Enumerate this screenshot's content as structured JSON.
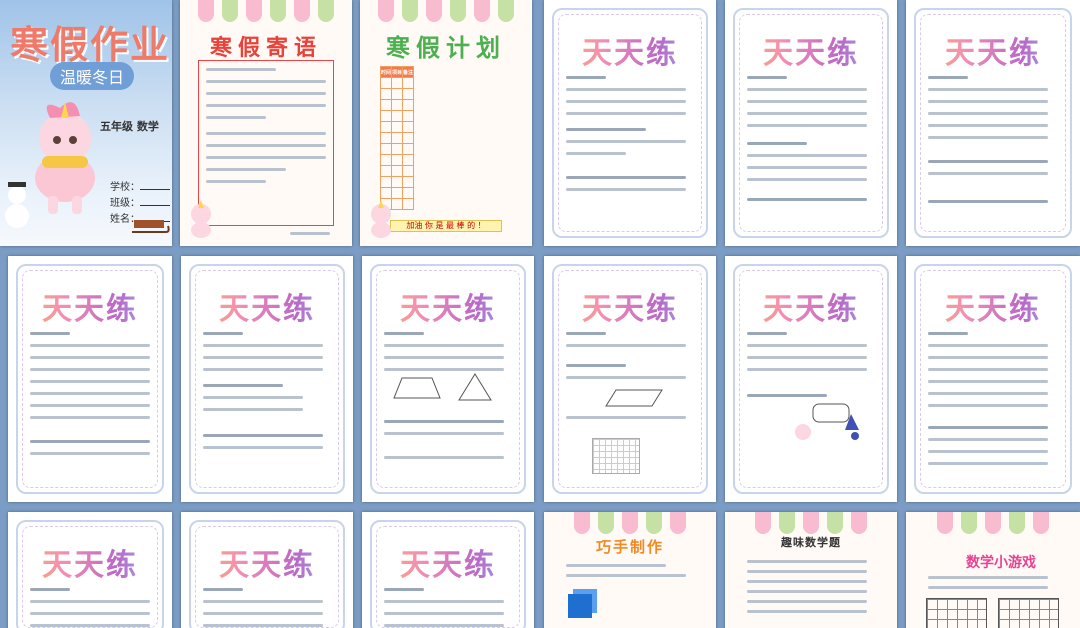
{
  "cover": {
    "title": "寒假作业",
    "subtitle": "温暖冬日",
    "grade": "五年级   数学",
    "fields": [
      "学校：",
      "班级：",
      "姓名："
    ]
  },
  "letter_page": {
    "title": "寒假寄语"
  },
  "plan_page": {
    "title": "寒假计划",
    "headers": [
      "时间",
      "项目",
      "备注"
    ],
    "footer": "加油 你 是 最 棒 的 ！"
  },
  "practice_title": "天天练",
  "craft_page": {
    "title": "巧手制作"
  },
  "puzzle_page": {
    "title": "趣味数学题"
  },
  "game_page": {
    "title": "数学小游戏"
  },
  "colors": {
    "background": "#7b9cc4",
    "cover_title": "#f07a6a",
    "red_title": "#e8433a",
    "green_title": "#4caf50"
  }
}
